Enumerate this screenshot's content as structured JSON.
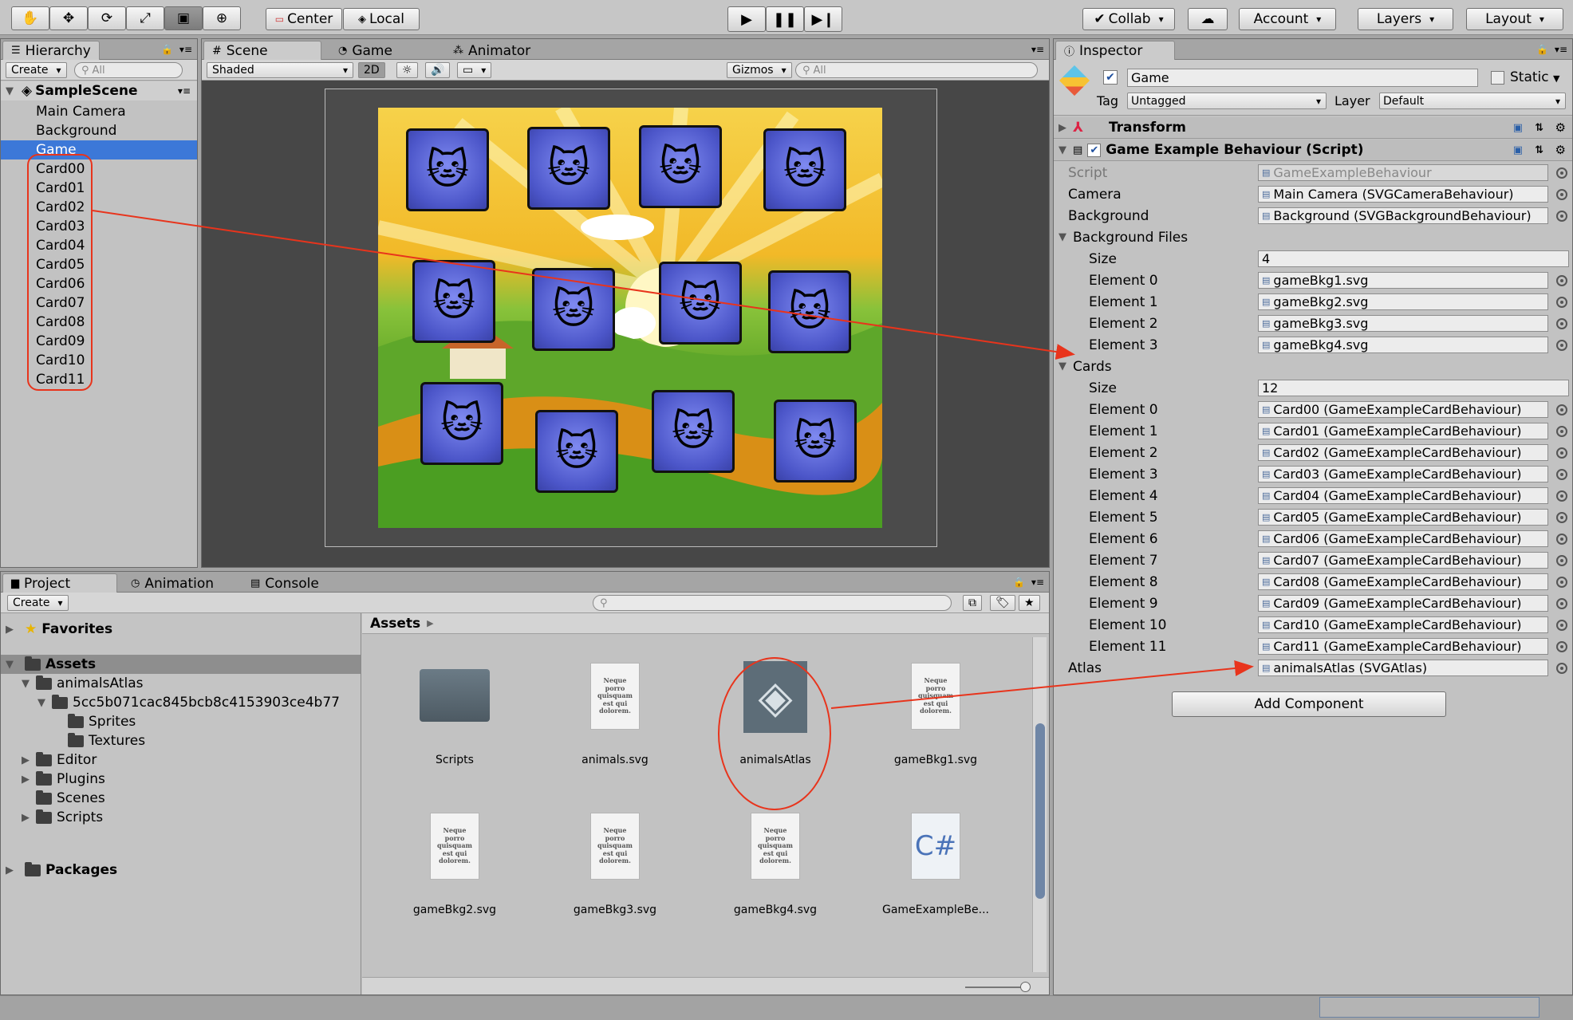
{
  "toolbar": {
    "pivot": "Center",
    "space": "Local",
    "collab": "Collab",
    "account": "Account",
    "layers": "Layers",
    "layout": "Layout",
    "transform_tools": [
      "hand-icon",
      "move-icon",
      "rotate-icon",
      "scale-icon",
      "rect-icon",
      "transform-icon"
    ],
    "playback": [
      "play-icon",
      "pause-icon",
      "step-icon"
    ]
  },
  "hierarchy": {
    "tab": "Hierarchy",
    "create": "Create",
    "search_placeholder": "All",
    "scene": "SampleScene",
    "items": [
      "Main Camera",
      "Background",
      "Game",
      "Card00",
      "Card01",
      "Card02",
      "Card03",
      "Card04",
      "Card05",
      "Card06",
      "Card07",
      "Card08",
      "Card09",
      "Card10",
      "Card11"
    ],
    "selected": "Game"
  },
  "scene_view": {
    "tabs": [
      "Scene",
      "Game",
      "Animator"
    ],
    "shading": "Shaded",
    "mode_2d": "2D",
    "gizmos": "Gizmos",
    "search_placeholder": "All"
  },
  "project": {
    "tabs": [
      "Project",
      "Animation",
      "Console"
    ],
    "create": "Create",
    "favorites": "Favorites",
    "assets_root": "Assets",
    "tree": [
      {
        "label": "animalsAtlas",
        "level": 1,
        "expanded": true
      },
      {
        "label": "5cc5b071cac845bcb8c4153903ce4b77",
        "level": 2,
        "expanded": true
      },
      {
        "label": "Sprites",
        "level": 3
      },
      {
        "label": "Textures",
        "level": 3
      },
      {
        "label": "Editor",
        "level": 1
      },
      {
        "label": "Plugins",
        "level": 1
      },
      {
        "label": "Scenes",
        "level": 1
      },
      {
        "label": "Scripts",
        "level": 1
      }
    ],
    "packages": "Packages",
    "breadcrumb": "Assets",
    "assets": [
      "Scripts",
      "animals.svg",
      "animalsAtlas",
      "gameBkg1.svg",
      "gameBkg2.svg",
      "gameBkg3.svg",
      "gameBkg4.svg",
      "GameExampleBe..."
    ],
    "doc_preview": "Neque porro quisquam est qui dolorem.",
    "csharp": "C#"
  },
  "inspector": {
    "tab": "Inspector",
    "object_name": "Game",
    "static": "Static",
    "tag_label": "Tag",
    "tag": "Untagged",
    "layer_label": "Layer",
    "layer": "Default",
    "transform": "Transform",
    "component": "Game Example Behaviour (Script)",
    "script_label": "Script",
    "script": "GameExampleBehaviour",
    "camera_label": "Camera",
    "camera": "Main Camera (SVGCameraBehaviour)",
    "background_label": "Background",
    "background": "Background (SVGBackgroundBehaviour)",
    "bgfiles_label": "Background Files",
    "size_label": "Size",
    "bgfiles_size": "4",
    "bgfiles": [
      "gameBkg1.svg",
      "gameBkg2.svg",
      "gameBkg3.svg",
      "gameBkg4.svg"
    ],
    "cards_label": "Cards",
    "cards_size": "12",
    "cards": [
      "Card00 (GameExampleCardBehaviour)",
      "Card01 (GameExampleCardBehaviour)",
      "Card02 (GameExampleCardBehaviour)",
      "Card03 (GameExampleCardBehaviour)",
      "Card04 (GameExampleCardBehaviour)",
      "Card05 (GameExampleCardBehaviour)",
      "Card06 (GameExampleCardBehaviour)",
      "Card07 (GameExampleCardBehaviour)",
      "Card08 (GameExampleCardBehaviour)",
      "Card09 (GameExampleCardBehaviour)",
      "Card10 (GameExampleCardBehaviour)",
      "Card11 (GameExampleCardBehaviour)"
    ],
    "element_labels": [
      "Element 0",
      "Element 1",
      "Element 2",
      "Element 3",
      "Element 4",
      "Element 5",
      "Element 6",
      "Element 7",
      "Element 8",
      "Element 9",
      "Element 10",
      "Element 11"
    ],
    "atlas_label": "Atlas",
    "atlas": "animalsAtlas (SVGAtlas)",
    "add_component": "Add Component"
  },
  "colors": {
    "selection": "#3c78d8",
    "annotation": "#e8341c"
  }
}
